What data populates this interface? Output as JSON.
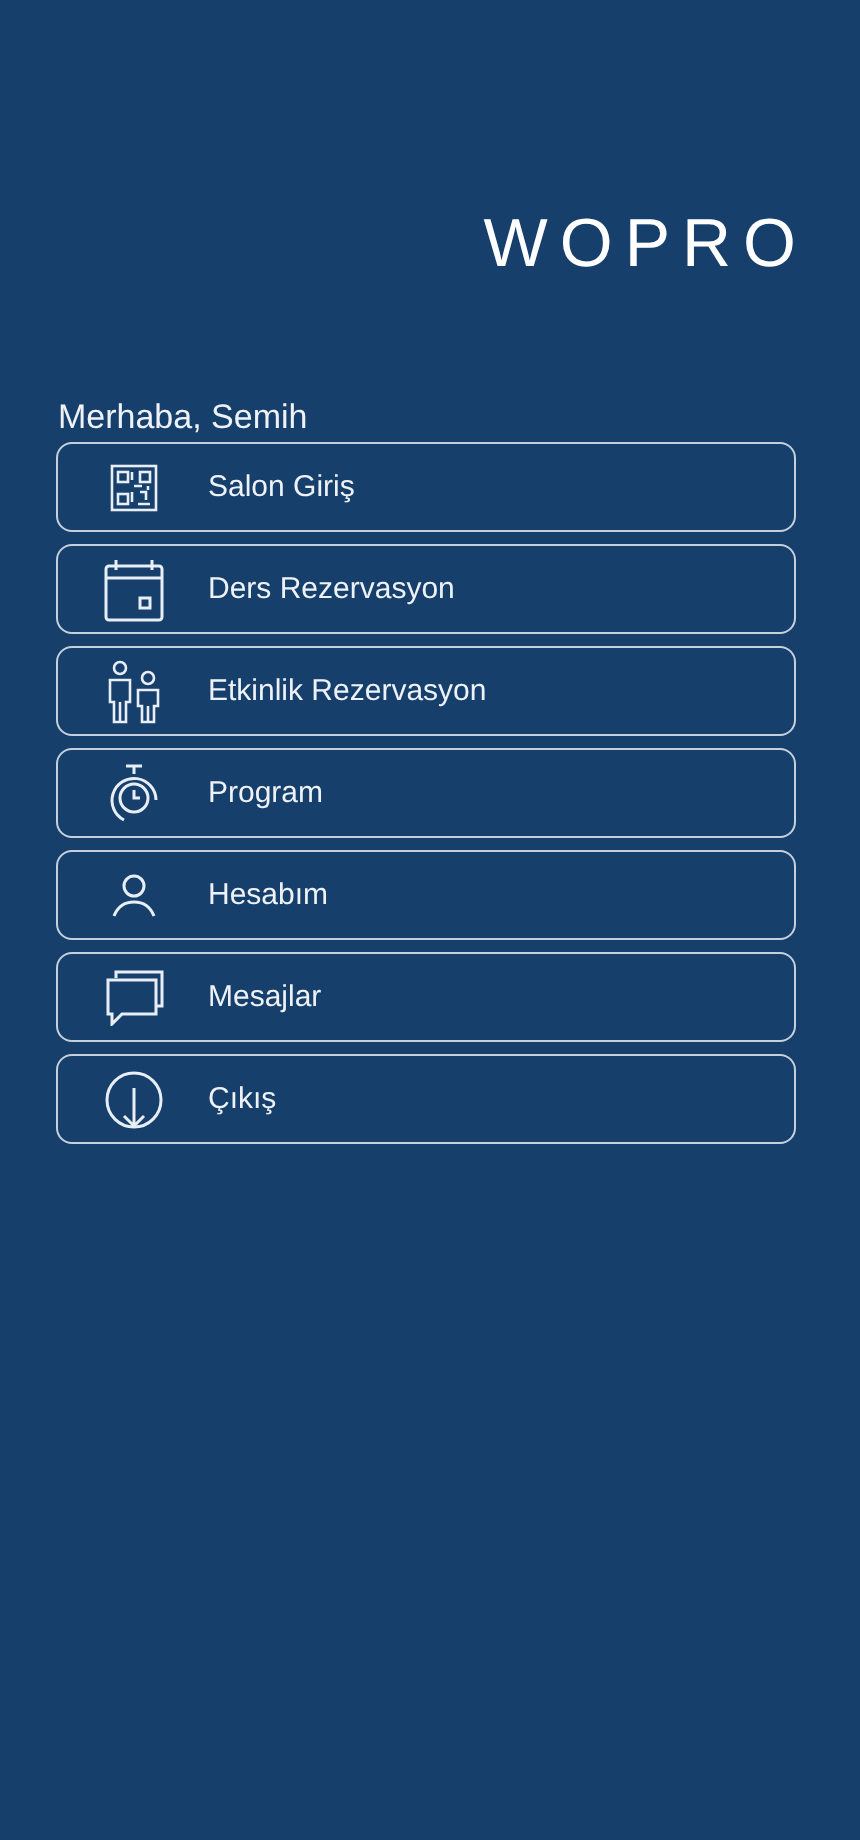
{
  "logo": "WOPRO",
  "greeting": "Merhaba, Semih",
  "menu": [
    {
      "label": "Salon Giriş"
    },
    {
      "label": "Ders Rezervasyon"
    },
    {
      "label": "Etkinlik Rezervasyon"
    },
    {
      "label": "Program"
    },
    {
      "label": "Hesabım"
    },
    {
      "label": "Mesajlar"
    },
    {
      "label": "Çıkış"
    }
  ]
}
